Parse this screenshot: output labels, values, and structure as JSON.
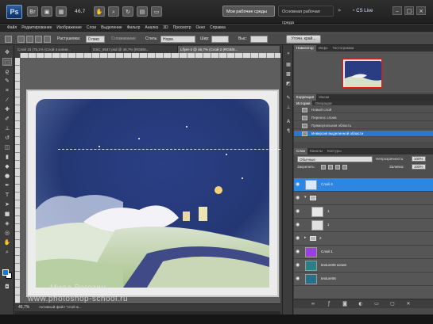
{
  "app": {
    "logo": "Ps",
    "zoom": "46,7",
    "workspace_active": "Мои рабочие среды",
    "workspace_other": "Основная рабочая среда",
    "cslive": "CS Live",
    "colors": {
      "selected_layer": "#2e86e0",
      "history_selected": "#2b78d0",
      "foreground_swatch": "#1677d6"
    }
  },
  "appbar_icons": [
    "bridge-icon",
    "minibridge-icon",
    "guides-icon",
    "zoom-level-icon",
    "hand-icon",
    "rotate-icon",
    "arrange-icon",
    "screen-mode-icon"
  ],
  "menu": [
    "Файл",
    "Редактирование",
    "Изображение",
    "Слои",
    "Выделение",
    "Фильтр",
    "Анализ",
    "3D",
    "Просмотр",
    "Окно",
    "Справка"
  ],
  "options": {
    "feather_label": "Растушевка:",
    "feather_value": "0 пикс",
    "antialias_label": "Сглаживание",
    "style_label": "Стиль:",
    "style_value": "Норм. пропорции",
    "width_label": "Шир:",
    "height_label": "Выс:",
    "refine_button": "Уточн. край..."
  },
  "tabs": [
    {
      "label": "Слой 15 (75,1% (Слой 4 копия...",
      "active": false
    },
    {
      "label": "DSC_8547.psd @ 46,7% (RGB/8...",
      "active": false
    },
    {
      "label": "Lflyer-2 @ 46,7% (Слой 2 (RGB/8...",
      "active": true
    }
  ],
  "canvas": {
    "watermark_name": "Мила Рогозин",
    "watermark_url": "www.photoshop-school.ru"
  },
  "status": {
    "zoom": "46,7%",
    "text": "Активный файл \"слой ж..."
  },
  "navigator": {
    "tabs": [
      "Навигатор",
      "Инфо",
      "Гистограмма"
    ]
  },
  "history": {
    "tabs": [
      "Коррекция",
      "Маски"
    ],
    "title_tabs": [
      "История",
      "Операции"
    ],
    "items": [
      {
        "label": "Новый слой",
        "active": false
      },
      {
        "label": "Перенос слоев",
        "active": false
      },
      {
        "label": "Прямоугольная область",
        "active": false
      },
      {
        "label": "Инверсия выделенной области",
        "active": true
      }
    ]
  },
  "layers": {
    "tabs": [
      "Слои",
      "Каналы",
      "Контуры"
    ],
    "blend_mode": "Обычные",
    "opacity_label": "Непрозрачность:",
    "opacity_value": "100%",
    "lock_label": "Закрепить:",
    "fill_label": "Заливка:",
    "fill_value": "100%",
    "items": [
      {
        "name": "Слой 4",
        "type": "layer",
        "active": true,
        "thumb": "#d9e9f8"
      },
      {
        "name": "",
        "type": "group",
        "active": false,
        "thumb": ""
      },
      {
        "name": "1",
        "type": "layer",
        "active": false,
        "thumb": "#e6e6e6"
      },
      {
        "name": "1",
        "type": "layer",
        "active": false,
        "thumb": "#e0e0e0"
      },
      {
        "name": "2",
        "type": "group",
        "active": false,
        "thumb": ""
      },
      {
        "name": "Слой 1",
        "type": "layer",
        "active": false,
        "thumb": "#9c3fe0"
      },
      {
        "name": "texture06 копия",
        "type": "layer",
        "active": false,
        "thumb": "#2b7f88"
      },
      {
        "name": "texture06",
        "type": "layer",
        "active": false,
        "thumb": "#2a6f88"
      }
    ]
  }
}
